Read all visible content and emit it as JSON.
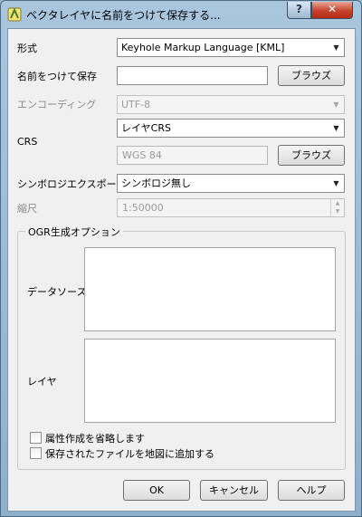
{
  "window": {
    "title": "ベクタレイヤに名前をつけて保存する...",
    "help_glyph": "?",
    "close_glyph": "✕"
  },
  "form": {
    "format_label": "形式",
    "format_value": "Keyhole Markup Language [KML]",
    "save_as_label": "名前をつけて保存",
    "save_as_value": "",
    "browse_label": "ブラウズ",
    "encoding_label": "エンコーディング",
    "encoding_value": "UTF-8",
    "crs_label": "CRS",
    "crs_value": "レイヤCRS",
    "crs_name": "WGS 84",
    "crs_browse_label": "ブラウズ",
    "symbology_label": "シンボロジエクスポート",
    "symbology_value": "シンボロジ無し",
    "scale_label": "縮尺",
    "scale_value": "1:50000"
  },
  "ogr": {
    "group_title": "OGR生成オプション",
    "datasource_label": "データソース",
    "layer_label": "レイヤ"
  },
  "options": {
    "skip_attributes_label": "属性作成を省略します",
    "add_to_map_label": "保存されたファイルを地図に追加する"
  },
  "buttons": {
    "ok": "OK",
    "cancel": "キャンセル",
    "help": "ヘルプ"
  },
  "icons": {
    "dropdown": "▼",
    "spin_up": "▲",
    "spin_down": "▼"
  }
}
